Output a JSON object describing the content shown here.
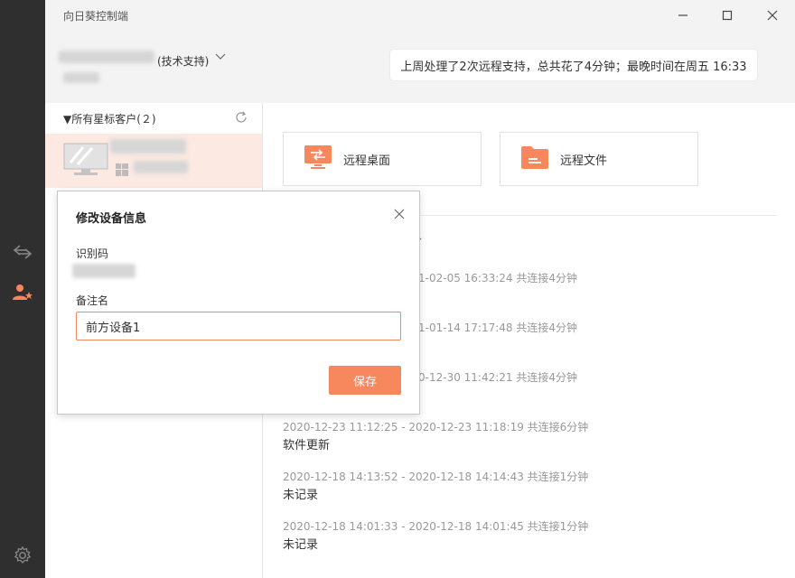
{
  "app": {
    "title": "向日葵控制端"
  },
  "account": {
    "role": "(技术支持)"
  },
  "notice": {
    "text": "上周处理了2次远程支持，总共花了4分钟；最晚时间在周五 16:33"
  },
  "device_list": {
    "group_label": "▼所有星标客户(２)"
  },
  "actions": [
    {
      "label": "远程桌面",
      "icon": "remote-desktop-icon"
    },
    {
      "label": "远程文件",
      "icon": "folder-icon"
    }
  ],
  "logs": [
    {
      "time": "1-02-05 16:33:24 共连接4分钟",
      "desc": ""
    },
    {
      "time": "1-01-14 17:17:48 共连接4分钟",
      "desc": ""
    },
    {
      "time": "0-12-30 11:42:21 共连接4分钟",
      "desc": ""
    },
    {
      "time": "2020-12-23 11:12:25 - 2020-12-23 11:18:19 共连接6分钟",
      "desc": "软件更新"
    },
    {
      "time": "2020-12-18 14:13:52 - 2020-12-18 14:14:43 共连接1分钟",
      "desc": "未记录"
    },
    {
      "time": "2020-12-18 14:01:33 - 2020-12-18 14:01:45 共连接1分钟",
      "desc": "未记录"
    }
  ],
  "dialog": {
    "title": "修改设备信息",
    "id_label": "识别码",
    "remark_label": "备注名",
    "remark_value": "前方设备1",
    "save_label": "保存"
  },
  "colors": {
    "accent": "#f7875c",
    "rail": "#2f2f2f",
    "selected_row": "#fbe9e2"
  }
}
